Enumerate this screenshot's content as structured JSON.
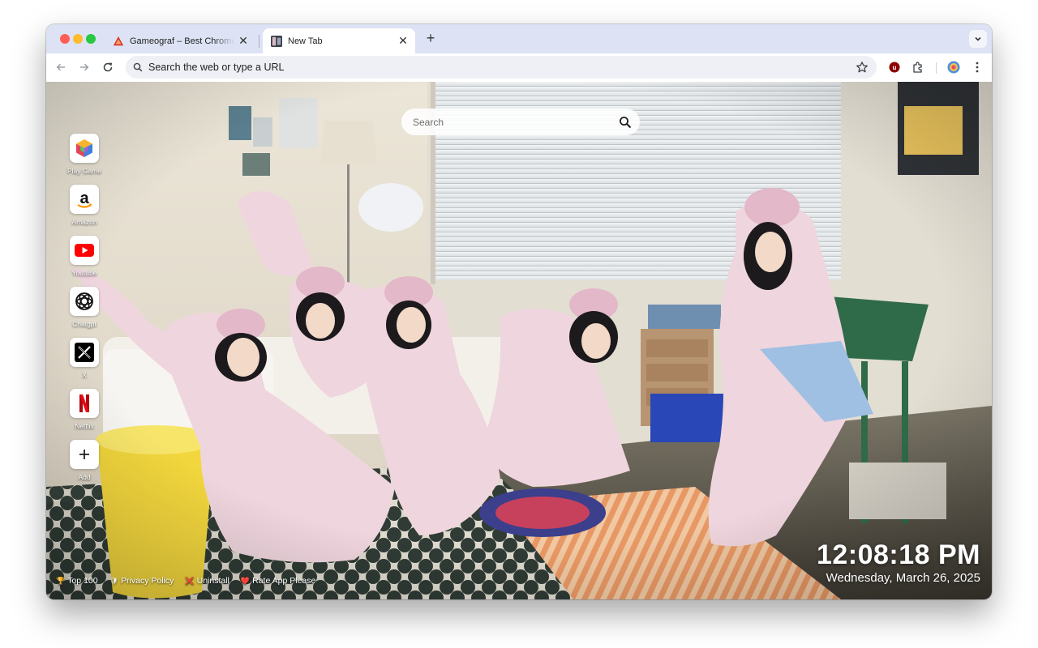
{
  "browser": {
    "tabs": [
      {
        "title": "Gameograf – Best Chrome Li",
        "favicon": "gameograf-icon",
        "active": false
      },
      {
        "title": "New Tab",
        "favicon": "newtab-wallpaper-icon",
        "active": true
      }
    ],
    "new_tab_symbol": "+",
    "omnibox": {
      "text": "Search the web or type a URL"
    },
    "close_symbol": "✕"
  },
  "newtab": {
    "search": {
      "placeholder": "Search"
    },
    "shortcuts": [
      {
        "label": "Play Game",
        "icon": "cube-icon"
      },
      {
        "label": "Amazon",
        "icon": "amazon-icon"
      },
      {
        "label": "Youtube",
        "icon": "youtube-icon"
      },
      {
        "label": "Chatgpt",
        "icon": "chatgpt-icon"
      },
      {
        "label": "X",
        "icon": "x-icon"
      },
      {
        "label": "Netflix",
        "icon": "netflix-icon"
      },
      {
        "label": "Add",
        "icon": "plus-icon"
      }
    ],
    "footer_links": [
      {
        "icon": "🏆",
        "label": "Top 100"
      },
      {
        "icon": "🛡",
        "label": "Privacy Policy"
      },
      {
        "icon": "❌",
        "label": "Uninstall"
      },
      {
        "icon": "❤️",
        "label": "Rate App Please"
      }
    ],
    "clock": {
      "time": "12:08:18 PM",
      "date": "Wednesday, March 26, 2025"
    }
  },
  "colors": {
    "tabstrip": "#dde3f5",
    "omnibox": "#eef0f5",
    "youtube_red": "#ff0000",
    "netflix_red": "#e50914"
  }
}
